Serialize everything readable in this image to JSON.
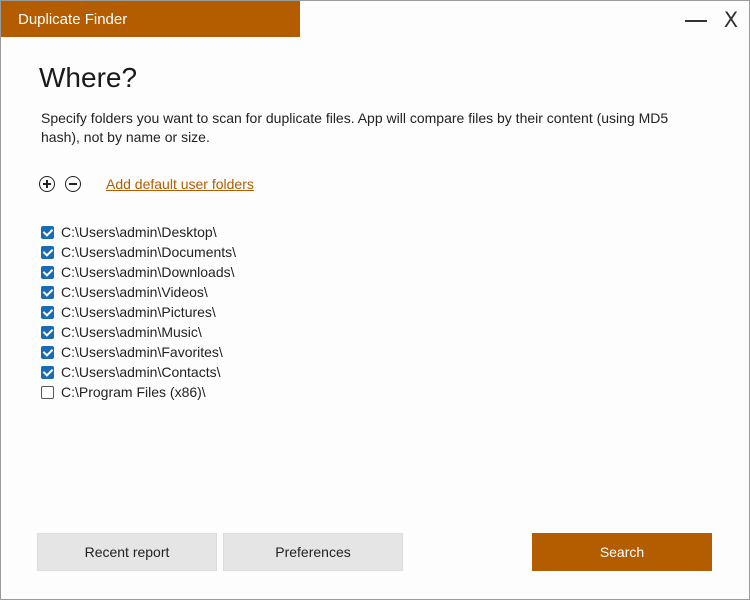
{
  "window": {
    "title": "Duplicate Finder",
    "close_glyph": "X"
  },
  "page": {
    "heading": "Where?",
    "description": "Specify folders you want to scan for duplicate files. App will compare files by their content (using MD5 hash), not by name or size."
  },
  "toolbar": {
    "add_icon": "plus-circle-icon",
    "remove_icon": "minus-circle-icon",
    "add_default_link": "Add default user folders"
  },
  "folders": [
    {
      "path": "C:\\Users\\admin\\Desktop\\",
      "checked": true
    },
    {
      "path": "C:\\Users\\admin\\Documents\\",
      "checked": true
    },
    {
      "path": "C:\\Users\\admin\\Downloads\\",
      "checked": true
    },
    {
      "path": "C:\\Users\\admin\\Videos\\",
      "checked": true
    },
    {
      "path": "C:\\Users\\admin\\Pictures\\",
      "checked": true
    },
    {
      "path": "C:\\Users\\admin\\Music\\",
      "checked": true
    },
    {
      "path": "C:\\Users\\admin\\Favorites\\",
      "checked": true
    },
    {
      "path": "C:\\Users\\admin\\Contacts\\",
      "checked": true
    },
    {
      "path": "C:\\Program Files (x86)\\",
      "checked": false
    }
  ],
  "buttons": {
    "recent_report": "Recent report",
    "preferences": "Preferences",
    "search": "Search"
  },
  "colors": {
    "accent": "#b35c00",
    "checkbox": "#1a6bb5"
  }
}
